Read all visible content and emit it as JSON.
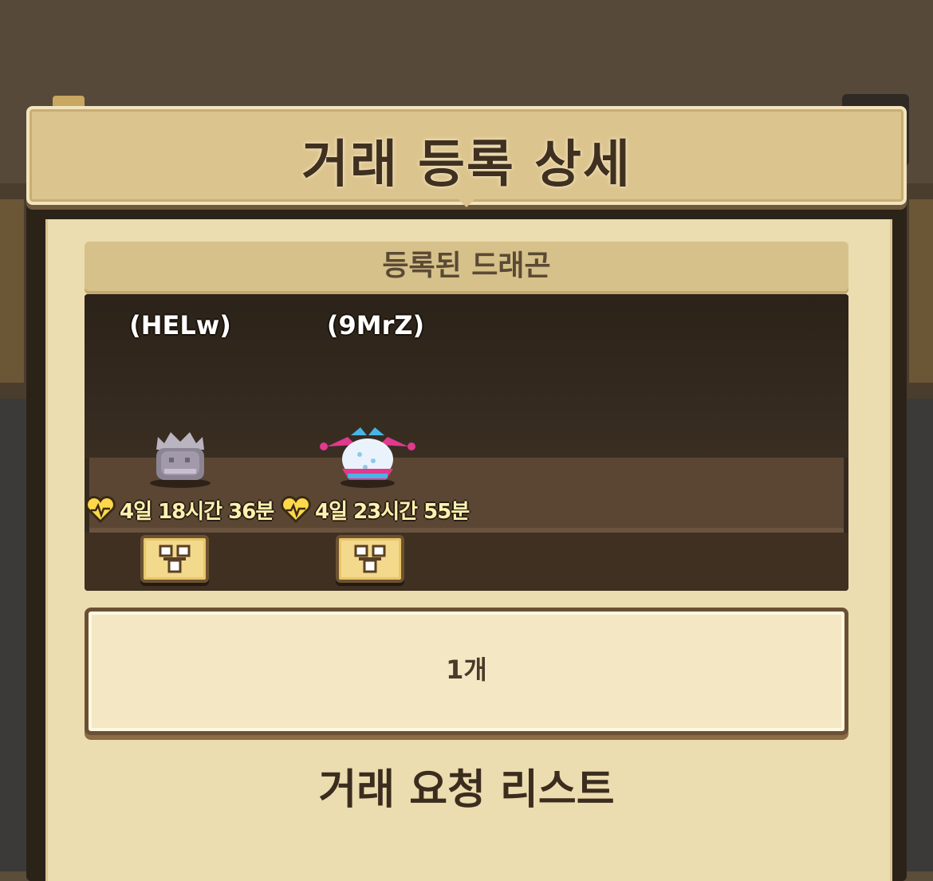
{
  "dialog": {
    "title": "거래 등록 상세",
    "registered_section_label": "등록된 드래곤",
    "dragons": [
      {
        "name": "(HELw)",
        "time_remaining": "4일 18시간 36분",
        "sprite": "grey-spiked-dragon-egg-sprite"
      },
      {
        "name": "(9MrZ)",
        "time_remaining": "4일 23시간 55분",
        "sprite": "jester-dragon-egg-sprite"
      }
    ],
    "count_text": "1개",
    "request_list_title": "거래 요청 리스트"
  },
  "icons": {
    "timer": "heart-pulse-icon",
    "trade": "trade-tree-icon"
  },
  "colors": {
    "banner": "#dcc48e",
    "panel": "#ecddb0",
    "timer_text": "#fff1b0",
    "heart": "#ffd84a"
  }
}
